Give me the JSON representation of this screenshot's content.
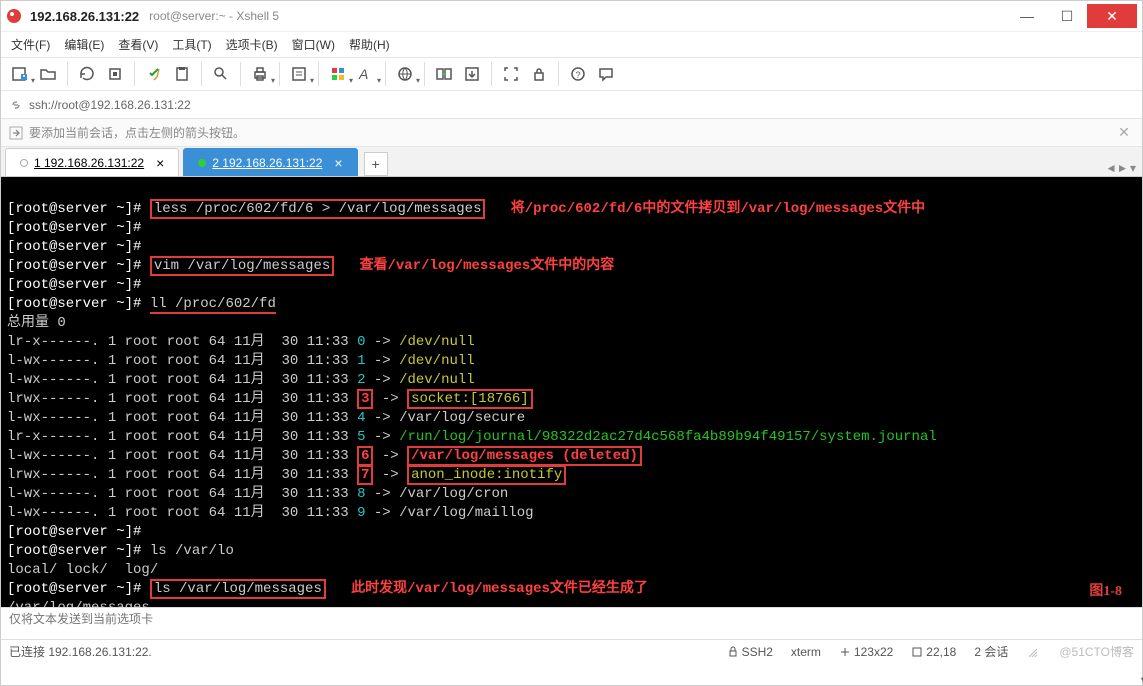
{
  "titlebar": {
    "host": "192.168.26.131:22",
    "sub": "root@server:~ - Xshell 5"
  },
  "menu": {
    "file": "文件(F)",
    "edit": "编辑(E)",
    "view": "查看(V)",
    "tools": "工具(T)",
    "tabs": "选项卡(B)",
    "window": "窗口(W)",
    "help": "帮助(H)"
  },
  "address": "ssh://root@192.168.26.131:22",
  "hint": "要添加当前会话，点击左侧的箭头按钮。",
  "tabs": {
    "t1": "1 192.168.26.131:22",
    "t2": "2 192.168.26.131:22"
  },
  "term": {
    "p": "[root@server ~]#",
    "cmd1": "less /proc/602/fd/6 > /var/log/messages",
    "note1": "将/proc/602/fd/6中的文件拷贝到/var/log/messages文件中",
    "cmd2": "vim /var/log/messages",
    "note2": "查看/var/log/messages文件中的内容",
    "cmd3": "ll /proc/602/fd",
    "total": "总用量 0",
    "fd0": {
      "perm": "lr-x------.",
      "rest": " 1 root root 64 11月  30 11:33 ",
      "num": "0",
      "arrow": " -> ",
      "target": "/dev/null"
    },
    "fd1": {
      "perm": "l-wx------.",
      "rest": " 1 root root 64 11月  30 11:33 ",
      "num": "1",
      "arrow": " -> ",
      "target": "/dev/null"
    },
    "fd2": {
      "perm": "l-wx------.",
      "rest": " 1 root root 64 11月  30 11:33 ",
      "num": "2",
      "arrow": " -> ",
      "target": "/dev/null"
    },
    "fd3": {
      "perm": "lrwx------.",
      "rest": " 1 root root 64 11月  30 11:33 ",
      "num": "3",
      "arrow": " -> ",
      "target": "socket:[18766]"
    },
    "fd4": {
      "perm": "l-wx------.",
      "rest": " 1 root root 64 11月  30 11:33 ",
      "num": "4",
      "arrow": " -> ",
      "target": "/var/log/secure"
    },
    "fd5": {
      "perm": "lr-x------.",
      "rest": " 1 root root 64 11月  30 11:33 ",
      "num": "5",
      "arrow": " -> ",
      "target": "/run/log/journal/98322d2ac27d4c568fa4b89b94f49157/system.journal"
    },
    "fd6": {
      "perm": "l-wx------.",
      "rest": " 1 root root 64 11月  30 11:33 ",
      "num": "6",
      "arrow": " -> ",
      "target": "/var/log/messages (deleted)"
    },
    "fd7": {
      "perm": "lrwx------.",
      "rest": " 1 root root 64 11月  30 11:33 ",
      "num": "7",
      "arrow": " -> ",
      "target": "anon_inode:inotify"
    },
    "fd8": {
      "perm": "l-wx------.",
      "rest": " 1 root root 64 11月  30 11:33 ",
      "num": "8",
      "arrow": " -> ",
      "target": "/var/log/cron"
    },
    "fd9": {
      "perm": "l-wx------.",
      "rest": " 1 root root 64 11月  30 11:33 ",
      "num": "9",
      "arrow": " -> ",
      "target": "/var/log/maillog"
    },
    "cmd4": "ls /var/lo",
    "lsout": "local/ lock/  log/",
    "cmd5": "ls /var/log/messages",
    "note5": "此时发现/var/log/messages文件已经生成了",
    "lsres": "/var/log/messages",
    "figlabel": "图1-8"
  },
  "input_placeholder": "仅将文本发送到当前选项卡",
  "status": {
    "conn": "已连接 192.168.26.131:22.",
    "ssh": "SSH2",
    "term": "xterm",
    "size": "123x22",
    "pos": "22,18",
    "sess": "2 会话",
    "wm": "@51CTO博客"
  }
}
